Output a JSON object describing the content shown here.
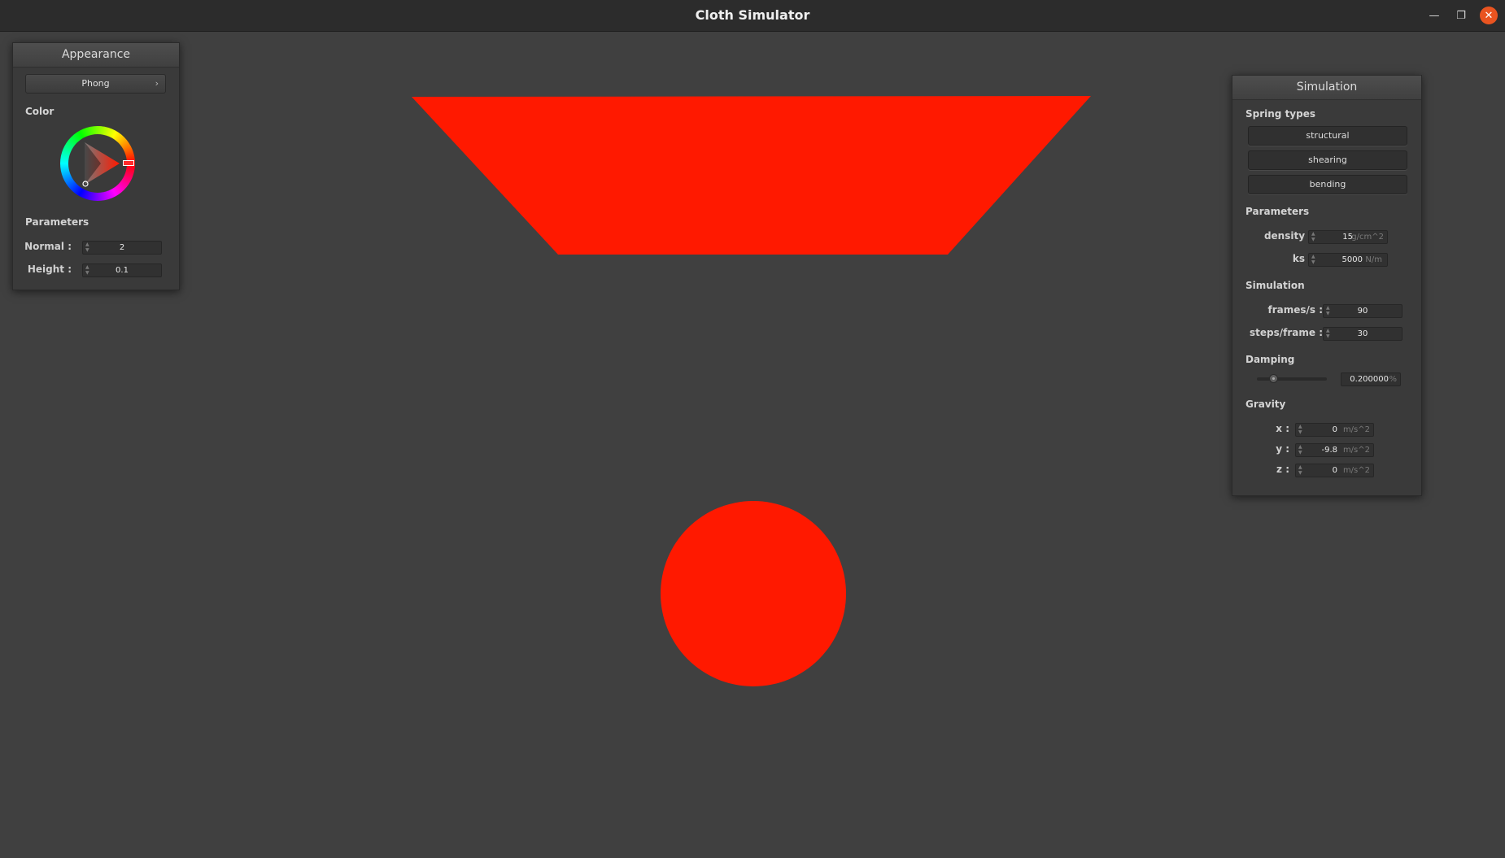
{
  "window": {
    "title": "Cloth Simulator"
  },
  "icons": {
    "minimize": "minimize-icon",
    "maximize": "maximize-icon",
    "close": "close-icon",
    "chevron": "chevron-right-icon",
    "spinner": "spinner-arrows-icon"
  },
  "colors": {
    "object": "#ff1900",
    "background": "#404040"
  },
  "appearance": {
    "title": "Appearance",
    "shader": "Phong",
    "color_label": "Color",
    "parameters_label": "Parameters",
    "normal_label": "Normal :",
    "normal_value": "2",
    "height_label": "Height :",
    "height_value": "0.1"
  },
  "simulation": {
    "title": "Simulation",
    "spring_types_label": "Spring types",
    "spring_types": [
      "structural",
      "shearing",
      "bending"
    ],
    "parameters_label": "Parameters",
    "density_label": "density :",
    "density_value": "15",
    "density_unit": "g/cm^2",
    "ks_label": "ks :",
    "ks_value": "5000",
    "ks_unit": "N/m",
    "simulation_label": "Simulation",
    "fps_label": "frames/s :",
    "fps_value": "90",
    "steps_label": "steps/frame :",
    "steps_value": "30",
    "damping_label": "Damping",
    "damping_value": "0.200000",
    "damping_unit": "%",
    "damping_level": 0.2,
    "gravity_label": "Gravity",
    "gx_label": "x :",
    "gx_value": "0",
    "gy_label": "y :",
    "gy_value": "-9.8",
    "gz_label": "z :",
    "gz_value": "0",
    "g_unit": "m/s^2"
  }
}
